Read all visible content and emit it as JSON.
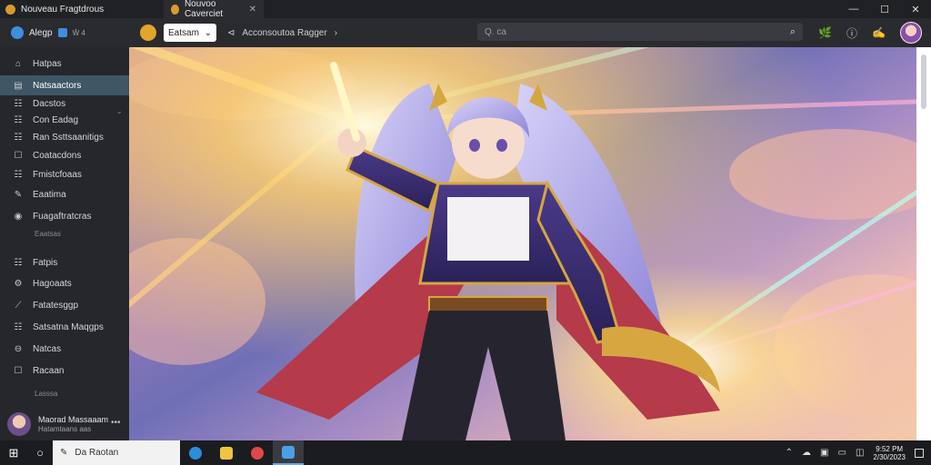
{
  "window": {
    "app_title": "Nouveau Fragtdrous",
    "tab_title": "Nouvoo Caverciet",
    "close_glyph": "✕",
    "minimize_glyph": "—",
    "maximize_glyph": "☐",
    "window_close_glyph": "✕"
  },
  "toolbar": {
    "brand": "Alegp",
    "brand_sub": "Ŵ 4",
    "select_value": "Eatsam",
    "select_chevron": "⌄",
    "breadcrumb_prefix": "⊲",
    "breadcrumb": "Acconsoutoa Ragger",
    "breadcrumb_suffix": "›",
    "search_placeholder": "Q. ca",
    "search_glyph": "⌕",
    "icons": [
      "🌿",
      "ⓘ",
      "✍"
    ]
  },
  "sidebar": {
    "items": [
      {
        "label": "Hatpas",
        "icon": "⌂"
      },
      {
        "label": "Natsaactors",
        "icon": "▤"
      },
      {
        "label": "Dacstos",
        "icon": "☷"
      },
      {
        "label": "Con Eadag",
        "icon": "☷"
      },
      {
        "label": "Ran Ssttsaanitigs",
        "icon": "☷"
      },
      {
        "label": "Coatacdons",
        "icon": "☐"
      },
      {
        "label": "Fmistcfoaas",
        "icon": "☷"
      },
      {
        "label": "Eaatima",
        "icon": "✎"
      },
      {
        "label": "Fuagaftratcras",
        "icon": "◉"
      },
      {
        "label": "Fatpis",
        "icon": "☷"
      },
      {
        "label": "Hagoaats",
        "icon": "⚙"
      },
      {
        "label": "Fatatesggp",
        "icon": "⟋"
      },
      {
        "label": "Satsatna Maqgps",
        "icon": "☷"
      },
      {
        "label": "Natcas",
        "icon": "⊖"
      },
      {
        "label": "Racaan",
        "icon": "☐"
      }
    ],
    "section_label_1": "Eaatsas",
    "section_label_2": "Lasssa",
    "expand_glyph": "⌄",
    "profile_name": "Maorad Massaaam",
    "profile_sub": "Hatamtaans aas",
    "profile_more": "•••"
  },
  "taskbar": {
    "start_glyph": "⊞",
    "task_glyph": "○",
    "search_icon": "✎",
    "search_text": "Da Raotan",
    "tray_icons": [
      "⌃",
      "☁",
      "▣",
      "▭",
      "◫"
    ],
    "time": "9:52 PM",
    "date": "2/30/2023"
  }
}
